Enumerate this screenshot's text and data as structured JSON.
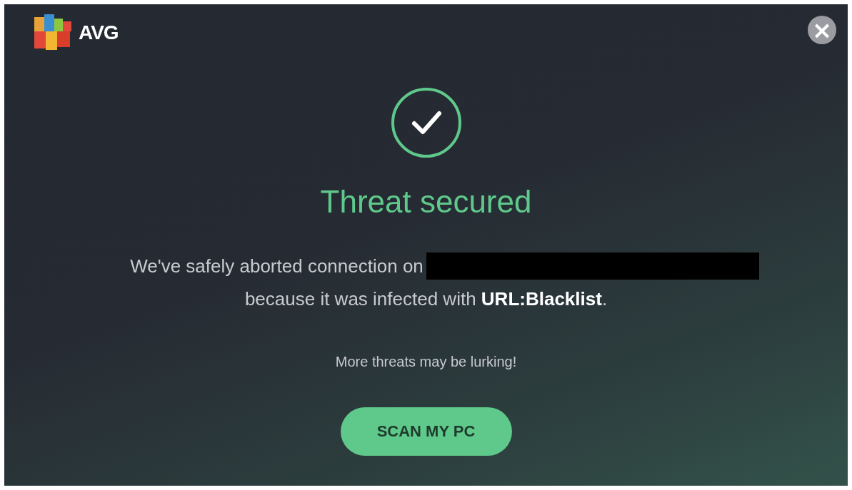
{
  "brand": {
    "name": "AVG"
  },
  "close": {
    "label": "×"
  },
  "title": "Threat secured",
  "message": {
    "line_1": "We've safely aborted connection on",
    "redacted": true,
    "line_2": "because it was infected with **URL:Blacklist**."
  },
  "note": "More threats may be lurking!",
  "button": {
    "label": "SCAN MY PC"
  }
}
